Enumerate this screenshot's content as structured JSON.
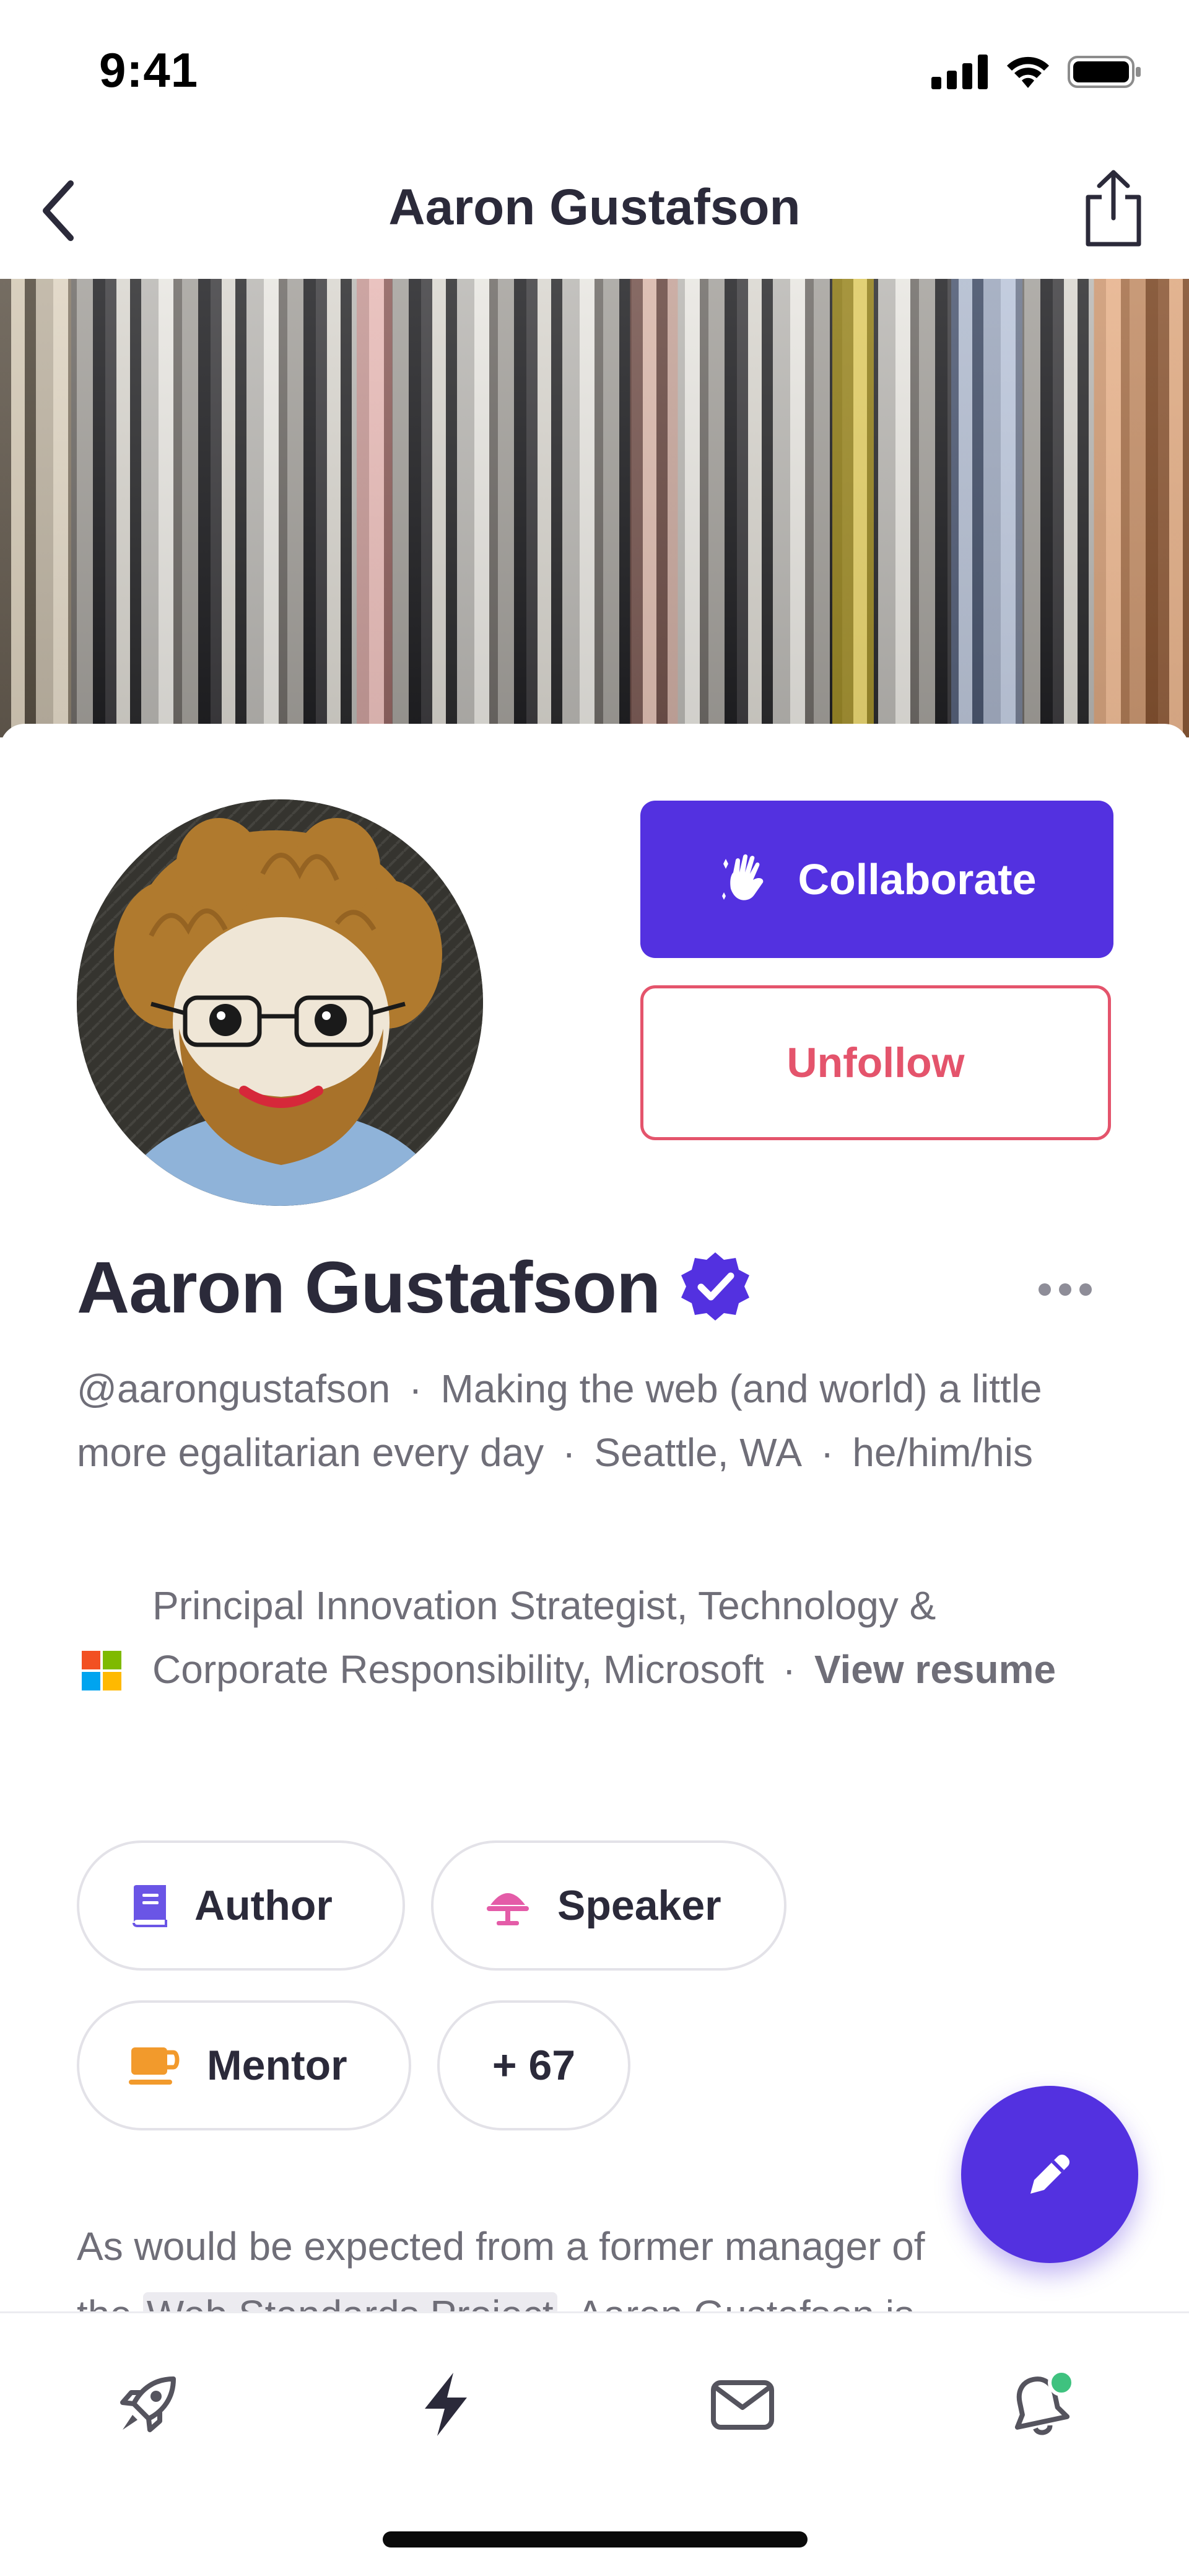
{
  "status_bar": {
    "time": "9:41"
  },
  "nav": {
    "title": "Aaron Gustafson"
  },
  "profile": {
    "name": "Aaron Gustafson",
    "handle": "@aarongustafson",
    "tagline": "Making the web (and world) a little more egalitarian every day",
    "location": "Seattle, WA",
    "pronouns": "he/him/his",
    "verified": true
  },
  "actions": {
    "collaborate_label": "Collaborate",
    "unfollow_label": "Unfollow"
  },
  "work": {
    "title": "Principal Innovation Strategist, Technology & Corporate Responsibility, Microsoft",
    "view_resume_label": "View resume"
  },
  "tags": [
    {
      "label": "Author",
      "icon": "book-icon"
    },
    {
      "label": "Speaker",
      "icon": "podium-icon"
    },
    {
      "label": "Mentor",
      "icon": "coffee-cup-icon"
    },
    {
      "label": "+ 67",
      "icon": ""
    }
  ],
  "about": {
    "line1": "As would be expected from a former manager of",
    "line2_prefix": "the",
    "line2_link": "Web Standards Project",
    "line2_suffix": ", Aaron Gustafson is"
  },
  "tab_bar": {
    "tabs": [
      {
        "name": "rocket-icon"
      },
      {
        "name": "lightning-icon"
      },
      {
        "name": "mail-icon"
      },
      {
        "name": "bell-icon"
      }
    ]
  },
  "colors": {
    "brand": "#5331e0",
    "unfollow": "#e4546c",
    "text": "#2b2a3a",
    "muted": "#6f6e78",
    "notification_dot": "#3fc27f"
  }
}
